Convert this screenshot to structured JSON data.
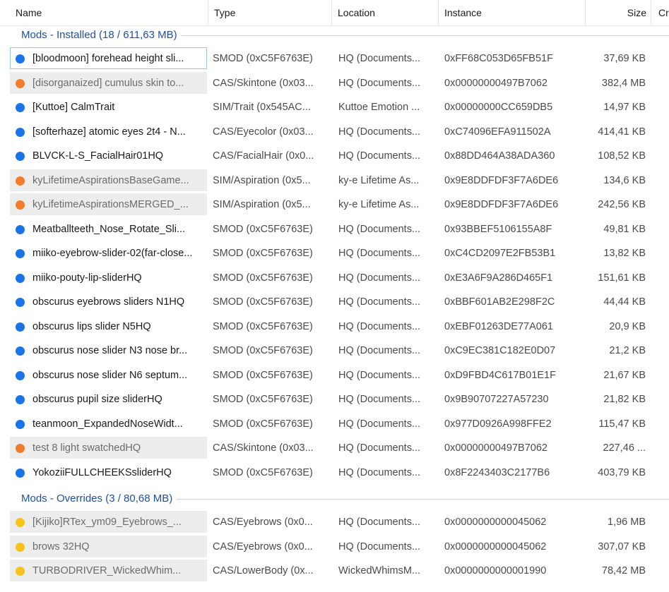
{
  "columns": {
    "name": "Name",
    "type": "Type",
    "location": "Location",
    "instance": "Instance",
    "size": "Size",
    "cr": "Cr"
  },
  "colors": {
    "blue": "#1a73e8",
    "orange": "#f07d2e",
    "yellow": "#f8c21c"
  },
  "groups": [
    {
      "title": "Mods - Installed  (18 / 611,63 MB)",
      "rows": [
        {
          "status": "blue",
          "dim": false,
          "selected": true,
          "name": "[bloodmoon] forehead height sli...",
          "type": "SMOD (0xC5F6763E)",
          "location": "HQ (Documents...",
          "instance": "0xFF68C053D65FB51F",
          "size": "37,69 KB"
        },
        {
          "status": "orange",
          "dim": true,
          "selected": false,
          "name": "[disorganaized] cumulus skin to...",
          "type": "CAS/Skintone (0x03...",
          "location": "HQ (Documents...",
          "instance": "0x00000000497B7062",
          "size": "382,4 MB"
        },
        {
          "status": "blue",
          "dim": false,
          "selected": false,
          "name": "[Kuttoe] CalmTrait",
          "type": "SIM/Trait (0x545AC...",
          "location": "Kuttoe Emotion ...",
          "instance": "0x00000000CC659DB5",
          "size": "14,97 KB"
        },
        {
          "status": "blue",
          "dim": false,
          "selected": false,
          "name": "[softerhaze] atomic eyes 2t4 - N...",
          "type": "CAS/Eyecolor (0x03...",
          "location": "HQ (Documents...",
          "instance": "0xC74096EFA911502A",
          "size": "414,41 KB"
        },
        {
          "status": "blue",
          "dim": false,
          "selected": false,
          "name": "BLVCK-L-S_FacialHair01HQ",
          "type": "CAS/FacialHair (0x0...",
          "location": "HQ (Documents...",
          "instance": "0x88DD464A38ADA360",
          "size": "108,52 KB"
        },
        {
          "status": "orange",
          "dim": true,
          "selected": false,
          "name": "kyLifetimeAspirationsBaseGame...",
          "type": "SIM/Aspiration (0x5...",
          "location": "ky-e Lifetime As...",
          "instance": "0x9E8DDFDF3F7A6DE6",
          "size": "134,6 KB"
        },
        {
          "status": "orange",
          "dim": true,
          "selected": false,
          "name": "kyLifetimeAspirationsMERGED_...",
          "type": "SIM/Aspiration (0x5...",
          "location": "ky-e Lifetime As...",
          "instance": "0x9E8DDFDF3F7A6DE6",
          "size": "242,56 KB"
        },
        {
          "status": "blue",
          "dim": false,
          "selected": false,
          "name": "Meatballteeth_Nose_Rotate_Sli...",
          "type": "SMOD (0xC5F6763E)",
          "location": "HQ (Documents...",
          "instance": "0x93BBEF5106155A8F",
          "size": "49,81 KB"
        },
        {
          "status": "blue",
          "dim": false,
          "selected": false,
          "name": "miiko-eyebrow-slider-02(far-close...",
          "type": "SMOD (0xC5F6763E)",
          "location": "HQ (Documents...",
          "instance": "0xC4CD2097E2FB53B1",
          "size": "13,82 KB"
        },
        {
          "status": "blue",
          "dim": false,
          "selected": false,
          "name": "miiko-pouty-lip-sliderHQ",
          "type": "SMOD (0xC5F6763E)",
          "location": "HQ (Documents...",
          "instance": "0xE3A6F9A286D465F1",
          "size": "151,61 KB"
        },
        {
          "status": "blue",
          "dim": false,
          "selected": false,
          "name": "obscurus eyebrows sliders N1HQ",
          "type": "SMOD (0xC5F6763E)",
          "location": "HQ (Documents...",
          "instance": "0xBBF601AB2E298F2C",
          "size": "44,44 KB"
        },
        {
          "status": "blue",
          "dim": false,
          "selected": false,
          "name": "obscurus lips slider N5HQ",
          "type": "SMOD (0xC5F6763E)",
          "location": "HQ (Documents...",
          "instance": "0xEBF01263DE77A061",
          "size": "20,9 KB"
        },
        {
          "status": "blue",
          "dim": false,
          "selected": false,
          "name": "obscurus nose slider N3 nose br...",
          "type": "SMOD (0xC5F6763E)",
          "location": "HQ (Documents...",
          "instance": "0xC9EC381C182E0D07",
          "size": "21,2 KB"
        },
        {
          "status": "blue",
          "dim": false,
          "selected": false,
          "name": "obscurus nose slider N6 septum...",
          "type": "SMOD (0xC5F6763E)",
          "location": "HQ (Documents...",
          "instance": "0xD9FBD4C617B01E1F",
          "size": "21,67 KB"
        },
        {
          "status": "blue",
          "dim": false,
          "selected": false,
          "name": "obscurus pupil size sliderHQ",
          "type": "SMOD (0xC5F6763E)",
          "location": "HQ (Documents...",
          "instance": "0x9B90707227A57230",
          "size": "21,82 KB"
        },
        {
          "status": "blue",
          "dim": false,
          "selected": false,
          "name": "teanmoon_ExpandedNoseWidt...",
          "type": "SMOD (0xC5F6763E)",
          "location": "HQ (Documents...",
          "instance": "0x977D0926A998FFE2",
          "size": "115,47 KB"
        },
        {
          "status": "orange",
          "dim": true,
          "selected": false,
          "name": "test 8 light swatchedHQ",
          "type": "CAS/Skintone (0x03...",
          "location": "HQ (Documents...",
          "instance": "0x00000000497B7062",
          "size": "227,46 ..."
        },
        {
          "status": "blue",
          "dim": false,
          "selected": false,
          "name": "YokoziiFULLCHEEKSsliderHQ",
          "type": "SMOD (0xC5F6763E)",
          "location": "HQ (Documents...",
          "instance": "0x8F2243403C2177B6",
          "size": "403,79 KB"
        }
      ]
    },
    {
      "title": "Mods - Overrides  (3 / 80,68 MB)",
      "rows": [
        {
          "status": "yellow",
          "dim": true,
          "selected": false,
          "name": "[Kijiko]RTex_ym09_Eyebrows_...",
          "type": "CAS/Eyebrows (0x0...",
          "location": "HQ (Documents...",
          "instance": "0x0000000000045062",
          "size": "1,96 MB"
        },
        {
          "status": "yellow",
          "dim": true,
          "selected": false,
          "name": "brows 32HQ",
          "type": "CAS/Eyebrows (0x0...",
          "location": "HQ (Documents...",
          "instance": "0x0000000000045062",
          "size": "307,07 KB"
        },
        {
          "status": "yellow",
          "dim": true,
          "selected": false,
          "name": "TURBODRIVER_WickedWhim...",
          "type": "CAS/LowerBody (0x...",
          "location": "WickedWhimsM...",
          "instance": "0x0000000000001990",
          "size": "78,42 MB"
        }
      ]
    }
  ]
}
